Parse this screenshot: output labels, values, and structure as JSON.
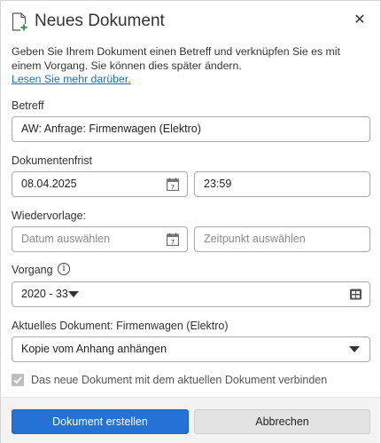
{
  "dialog": {
    "title": "Neues Dokument",
    "close_icon": "close-icon",
    "intro": "Geben Sie Ihrem Dokument einen Betreff und verknüpfen Sie es mit einem Vorgang. Sie können dies später ändern.",
    "learn_more": "Lesen Sie mehr darüber."
  },
  "betreff": {
    "label": "Betreff",
    "value": "AW: Anfrage: Firmenwagen (Elektro)"
  },
  "frist": {
    "label": "Dokumentenfrist",
    "date": "08.04.2025",
    "time": "23:59"
  },
  "wiedervorlage": {
    "label": "Wiedervorlage:",
    "date_placeholder": "Datum auswählen",
    "time_placeholder": "Zeitpunkt auswählen"
  },
  "vorgang": {
    "label": "Vorgang",
    "value": "2020 - 33"
  },
  "aktuelles": {
    "label": "Aktuelles Dokument: Firmenwagen (Elektro)",
    "option": "Kopie vom Anhang anhängen"
  },
  "verbinden": {
    "label": "Das neue Dokument mit dem aktuellen Dokument verbinden",
    "checked": true
  },
  "footer": {
    "create": "Dokument erstellen",
    "cancel": "Abbrechen"
  },
  "colors": {
    "primary": "#2472d6",
    "link": "#1a6fc4"
  }
}
